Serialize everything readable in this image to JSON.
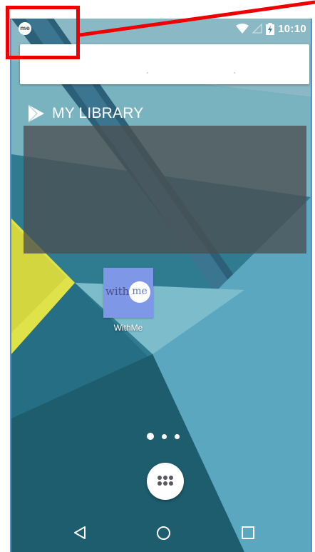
{
  "status_bar": {
    "notification_icon_text": "me",
    "clock": "10:10",
    "icons": [
      "wifi-icon",
      "signal-icon",
      "battery-charging-icon"
    ]
  },
  "search_bar": {
    "visible": true
  },
  "library_widget": {
    "title": "MY LIBRARY",
    "icon": "play-store-icon"
  },
  "apps": [
    {
      "name": "WithMe",
      "icon_text_left": "with",
      "icon_text_circle": "me",
      "icon_color": "#7f97e7"
    }
  ],
  "home_pages": {
    "count": 3,
    "current_index": 0
  },
  "dock": {
    "app_drawer_icon": "app-drawer-icon"
  },
  "nav_bar": {
    "buttons": [
      "back-icon",
      "home-icon",
      "recents-icon"
    ]
  },
  "annotation": {
    "color": "#ee0000"
  },
  "colors": {
    "wall_dark": "#1d5d6e",
    "wall_light": "#5aa7bf",
    "accent_yellow": "#e3e74a"
  }
}
